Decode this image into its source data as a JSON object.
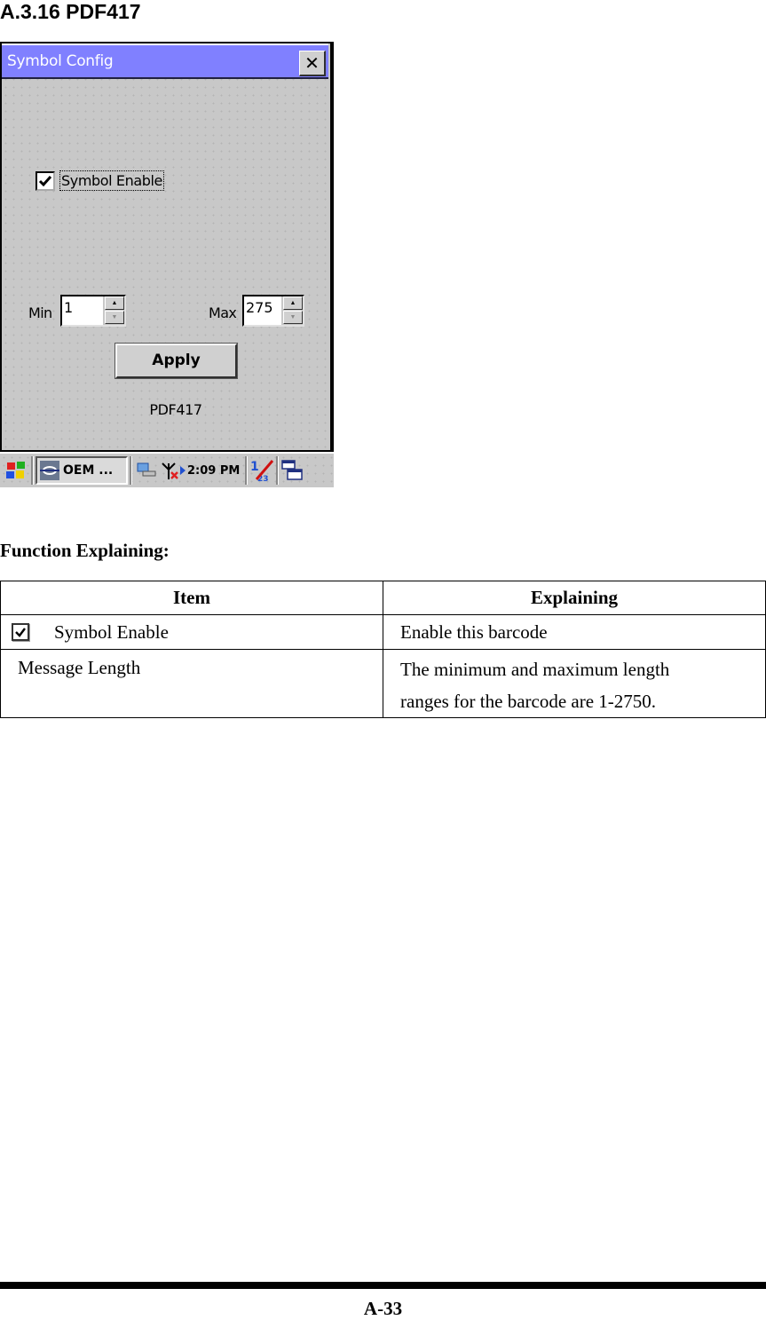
{
  "section": {
    "title": "A.3.16 PDF417"
  },
  "window": {
    "title": "Symbol Config",
    "close_label": "✕",
    "symbol_enable": {
      "label": "Symbol Enable",
      "checked": true
    },
    "min": {
      "label": "Min",
      "value": "1"
    },
    "max": {
      "label": "Max",
      "value": "275"
    },
    "apply_label": "Apply",
    "symbol_name": "PDF417"
  },
  "taskbar": {
    "task_label": "OEM ...",
    "clock": "2:09 PM",
    "icons": [
      "windows-start-icon",
      "oem-app-icon",
      "network-icon",
      "antenna-disconnected-icon",
      "input-panel-icon",
      "switch-windows-icon"
    ]
  },
  "function_explaining": {
    "heading": "Function Explaining:",
    "headers": {
      "item": "Item",
      "explaining": "Explaining"
    },
    "rows": [
      {
        "item": "Symbol Enable",
        "explaining": "Enable this barcode"
      },
      {
        "item": "Message Length",
        "explaining_line1": "The minimum and maximum length",
        "explaining_line2": "ranges for the barcode are 1-2750."
      }
    ]
  },
  "footer": {
    "page_number": "A-33"
  }
}
